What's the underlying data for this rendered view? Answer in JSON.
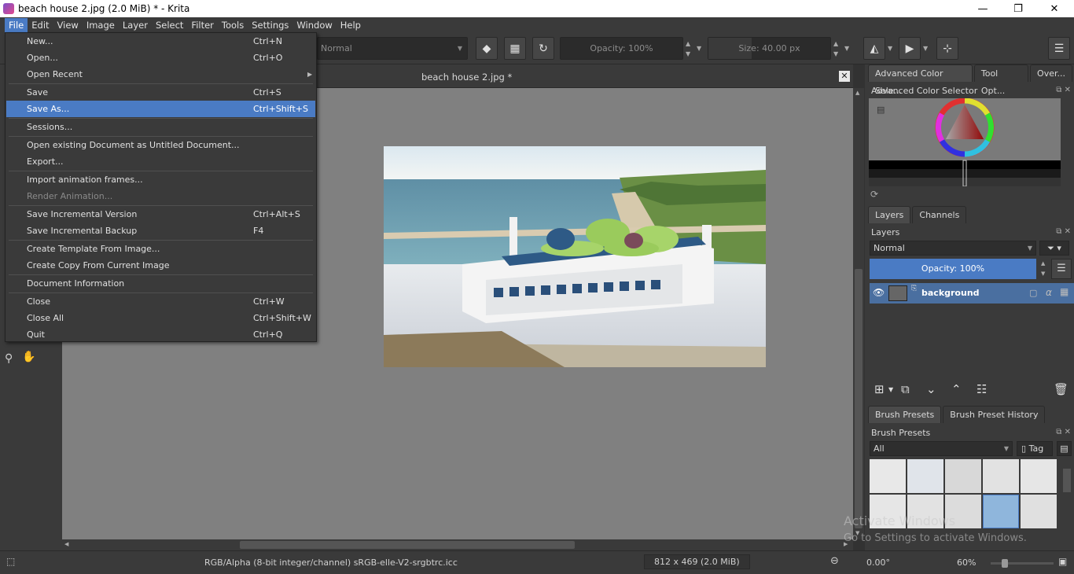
{
  "window": {
    "title": "beach house 2.jpg (2.0 MiB)  * - Krita",
    "minimize": "—",
    "restore": "❐",
    "close": "✕"
  },
  "menubar": {
    "items": [
      "File",
      "Edit",
      "View",
      "Image",
      "Layer",
      "Select",
      "Filter",
      "Tools",
      "Settings",
      "Window",
      "Help"
    ]
  },
  "toolbar": {
    "blend_mode": "Normal",
    "opacity": "Opacity: 100%",
    "size": "Size: 40.00 px"
  },
  "canvas": {
    "document_title": "beach house 2.jpg *",
    "close_glyph": "✕"
  },
  "file_menu": {
    "items": [
      {
        "label": "New...",
        "shortcut": "Ctrl+N"
      },
      {
        "label": "Open...",
        "shortcut": "Ctrl+O"
      },
      {
        "label": "Open Recent",
        "shortcut": ""
      },
      {
        "label": "Save",
        "shortcut": "Ctrl+S"
      },
      {
        "label": "Save As...",
        "shortcut": "Ctrl+Shift+S"
      },
      {
        "label": "Sessions...",
        "shortcut": ""
      },
      {
        "label": "Open existing Document as Untitled Document...",
        "shortcut": ""
      },
      {
        "label": "Export...",
        "shortcut": ""
      },
      {
        "label": "Import animation frames...",
        "shortcut": ""
      },
      {
        "label": "Render Animation...",
        "shortcut": ""
      },
      {
        "label": "Save Incremental Version",
        "shortcut": "Ctrl+Alt+S"
      },
      {
        "label": "Save Incremental Backup",
        "shortcut": "F4"
      },
      {
        "label": "Create Template From Image...",
        "shortcut": ""
      },
      {
        "label": "Create Copy From Current Image",
        "shortcut": ""
      },
      {
        "label": "Document Information",
        "shortcut": ""
      },
      {
        "label": "Close",
        "shortcut": "Ctrl+W"
      },
      {
        "label": "Close All",
        "shortcut": "Ctrl+Shift+W"
      },
      {
        "label": "Quit",
        "shortcut": "Ctrl+Q"
      }
    ],
    "highlighted": "Save As...",
    "disabled": "Render Animation..."
  },
  "docker": {
    "top_tabs": [
      "Advanced Color Sele...",
      "Tool Opt...",
      "Over..."
    ],
    "color_selector_title": "Advanced Color Selector",
    "layers_tabs": [
      "Layers",
      "Channels"
    ],
    "layers_title": "Layers",
    "layers_blend": "Normal",
    "layers_opacity": "Opacity:  100%",
    "layer_name": "background",
    "brush_tabs": [
      "Brush Presets",
      "Brush Preset History"
    ],
    "brush_title": "Brush Presets",
    "brush_filter": "All",
    "brush_tag": "Tag"
  },
  "statusbar": {
    "color_info": "RGB/Alpha (8-bit integer/channel)  sRGB-elle-V2-srgbtrc.icc",
    "dimensions": "812 x 469 (2.0 MiB)",
    "rotation": "0.00°",
    "zoom": "60%"
  },
  "watermark": {
    "line1": "Activate Windows",
    "line2": "Go to Settings to activate Windows."
  },
  "colors": {
    "accent": "#4a7bc4",
    "panel": "#3a3a3a",
    "canvas": "#808080"
  }
}
